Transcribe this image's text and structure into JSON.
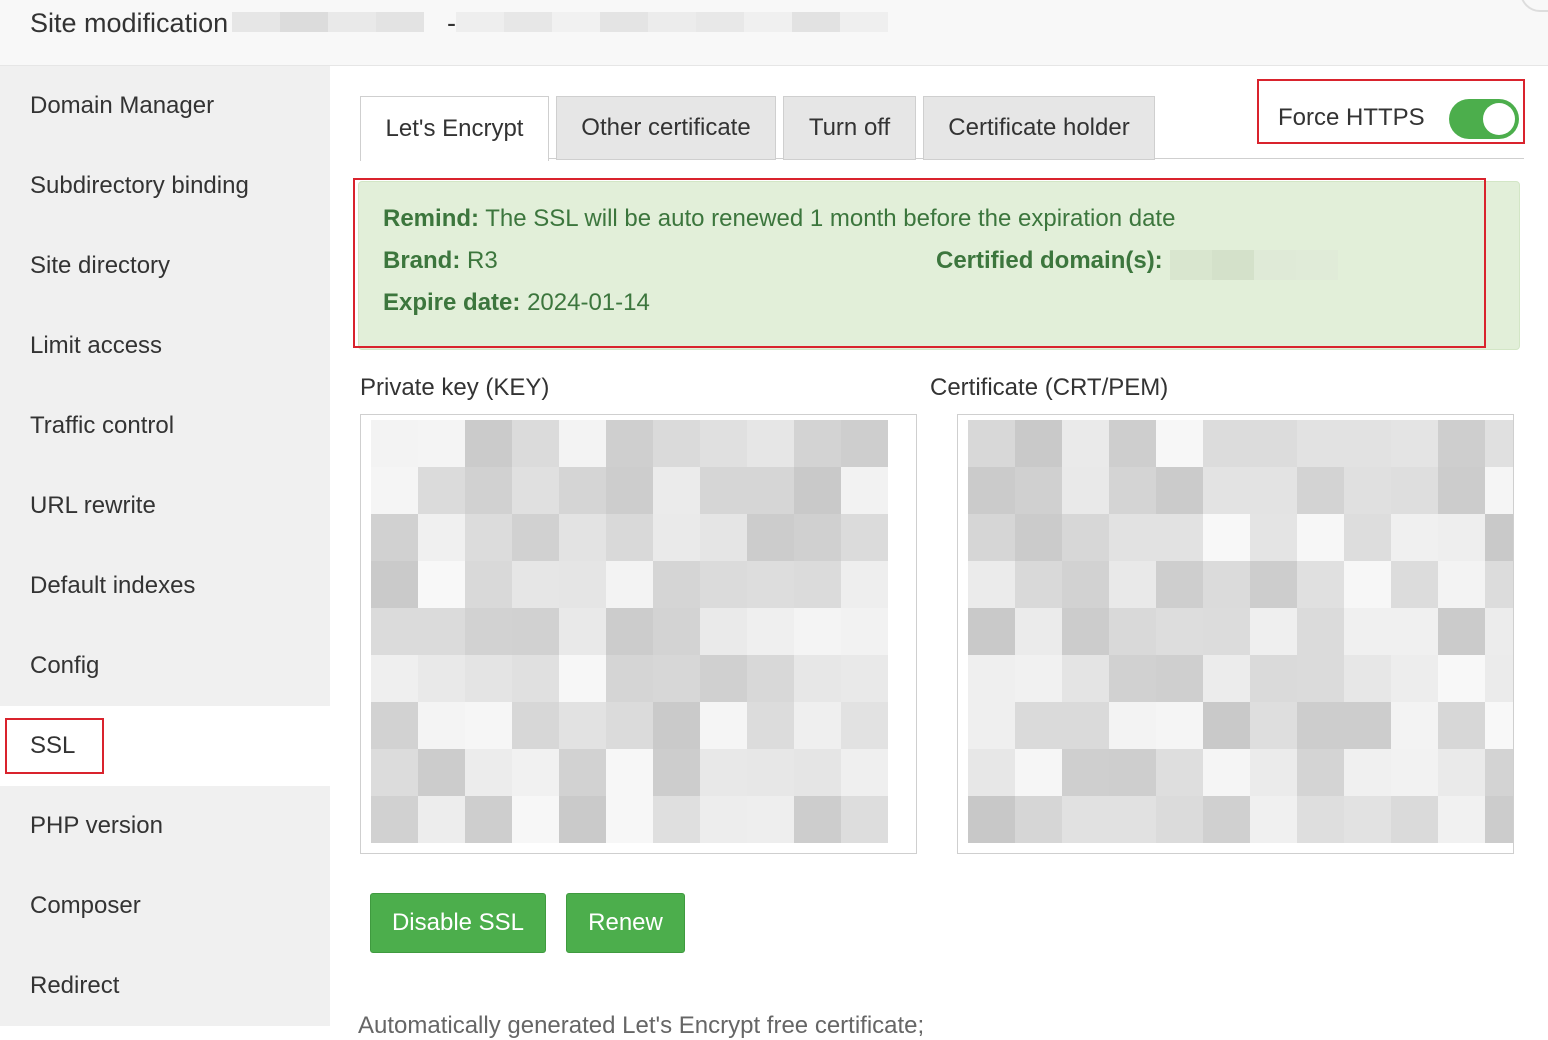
{
  "window": {
    "title": "Site modification",
    "separator": "-"
  },
  "sidebar": {
    "items": [
      {
        "label": "Domain Manager"
      },
      {
        "label": "Subdirectory binding"
      },
      {
        "label": "Site directory"
      },
      {
        "label": "Limit access"
      },
      {
        "label": "Traffic control"
      },
      {
        "label": "URL rewrite"
      },
      {
        "label": "Default indexes"
      },
      {
        "label": "Config"
      },
      {
        "label": "SSL"
      },
      {
        "label": "PHP version"
      },
      {
        "label": "Composer"
      },
      {
        "label": "Redirect"
      }
    ],
    "active": "SSL"
  },
  "tabs": [
    {
      "label": "Let's Encrypt",
      "active": true
    },
    {
      "label": "Other certificate",
      "active": false
    },
    {
      "label": "Turn off",
      "active": false
    },
    {
      "label": "Certificate holder",
      "active": false
    }
  ],
  "force_https": {
    "label": "Force HTTPS",
    "enabled": true
  },
  "alert": {
    "remind_label": "Remind:",
    "remind_text": "The SSL will be auto renewed 1 month before the expiration date",
    "brand_label": "Brand:",
    "brand_value": "R3",
    "domains_label": "Certified domain(s):",
    "expire_label": "Expire date:",
    "expire_value": "2024-01-14"
  },
  "fields": {
    "key_label": "Private key (KEY)",
    "cert_label": "Certificate (CRT/PEM)"
  },
  "buttons": {
    "disable_ssl": "Disable SSL",
    "renew": "Renew"
  },
  "footnote": "Automatically generated Let's Encrypt free certificate;",
  "colors": {
    "accent_green": "#4cae4c",
    "alert_bg": "#e2efd9",
    "alert_text": "#3c763d",
    "highlight_red": "#d9232d"
  }
}
